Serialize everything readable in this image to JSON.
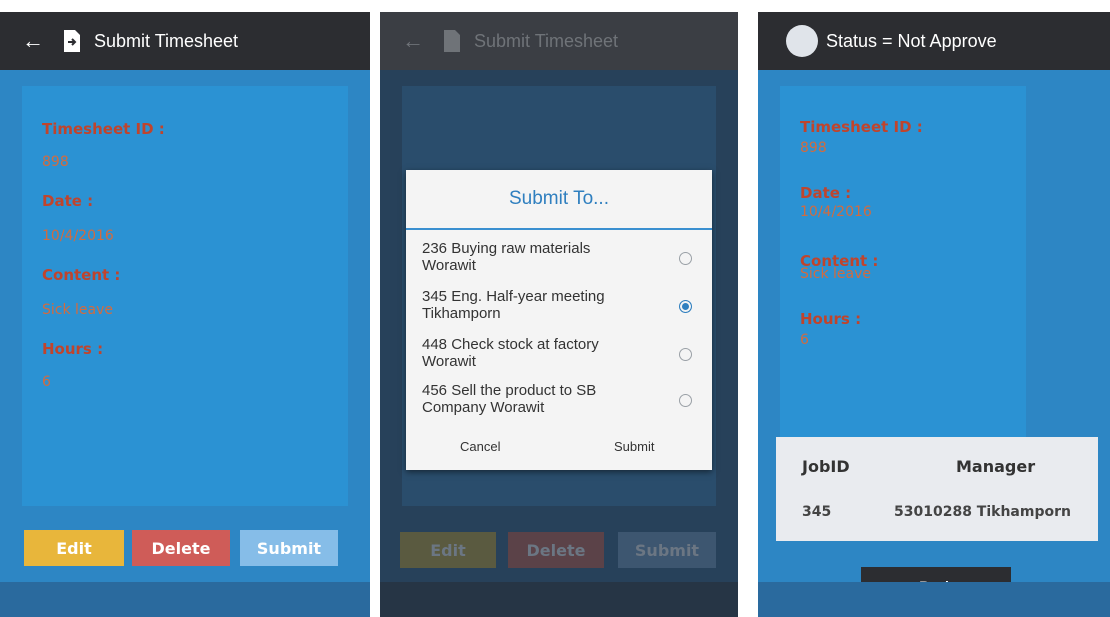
{
  "screen1": {
    "title": "Submit Timesheet",
    "fields": [
      {
        "label": "Timesheet ID :",
        "value": "898"
      },
      {
        "label": "Date :",
        "value": "10/4/2016"
      },
      {
        "label": "Content :",
        "value": "Sick leave"
      },
      {
        "label": "Hours :",
        "value": "6"
      }
    ],
    "buttons": {
      "edit": "Edit",
      "delete": "Delete",
      "submit": "Submit"
    },
    "colors": {
      "edit": "#e8b63b",
      "delete": "#cf5c58",
      "submit": "#86bde8"
    }
  },
  "screen2": {
    "title": "Submit Timesheet",
    "buttons": {
      "edit": "Edit",
      "delete": "Delete",
      "submit": "Submit"
    },
    "dialog": {
      "title": "Submit To...",
      "options": [
        {
          "line1": "236 Buying raw materials",
          "line2": "Worawit",
          "selected": false
        },
        {
          "line1": "345 Eng. Half-year meeting",
          "line2": "Tikhamporn",
          "selected": true
        },
        {
          "line1": "448 Check stock at factory",
          "line2": "Worawit",
          "selected": false
        },
        {
          "line1": "456 Sell the product to SB",
          "line2": "Company Worawit",
          "selected": false
        }
      ],
      "cancel": "Cancel",
      "submit": "Submit"
    }
  },
  "screen3": {
    "title": "Status = Not Approve",
    "fields": [
      {
        "label": "Timesheet ID :",
        "value": "898"
      },
      {
        "label": "Date :",
        "value": "10/4/2016"
      },
      {
        "label": "Content :",
        "value": "Sick leave"
      },
      {
        "label": "Hours :",
        "value": "6"
      }
    ],
    "table": {
      "headers": [
        "JobID",
        "Manager"
      ],
      "row": {
        "jobid": "345",
        "manager": "53010288 Tikhamporn"
      }
    },
    "back": "Back"
  }
}
